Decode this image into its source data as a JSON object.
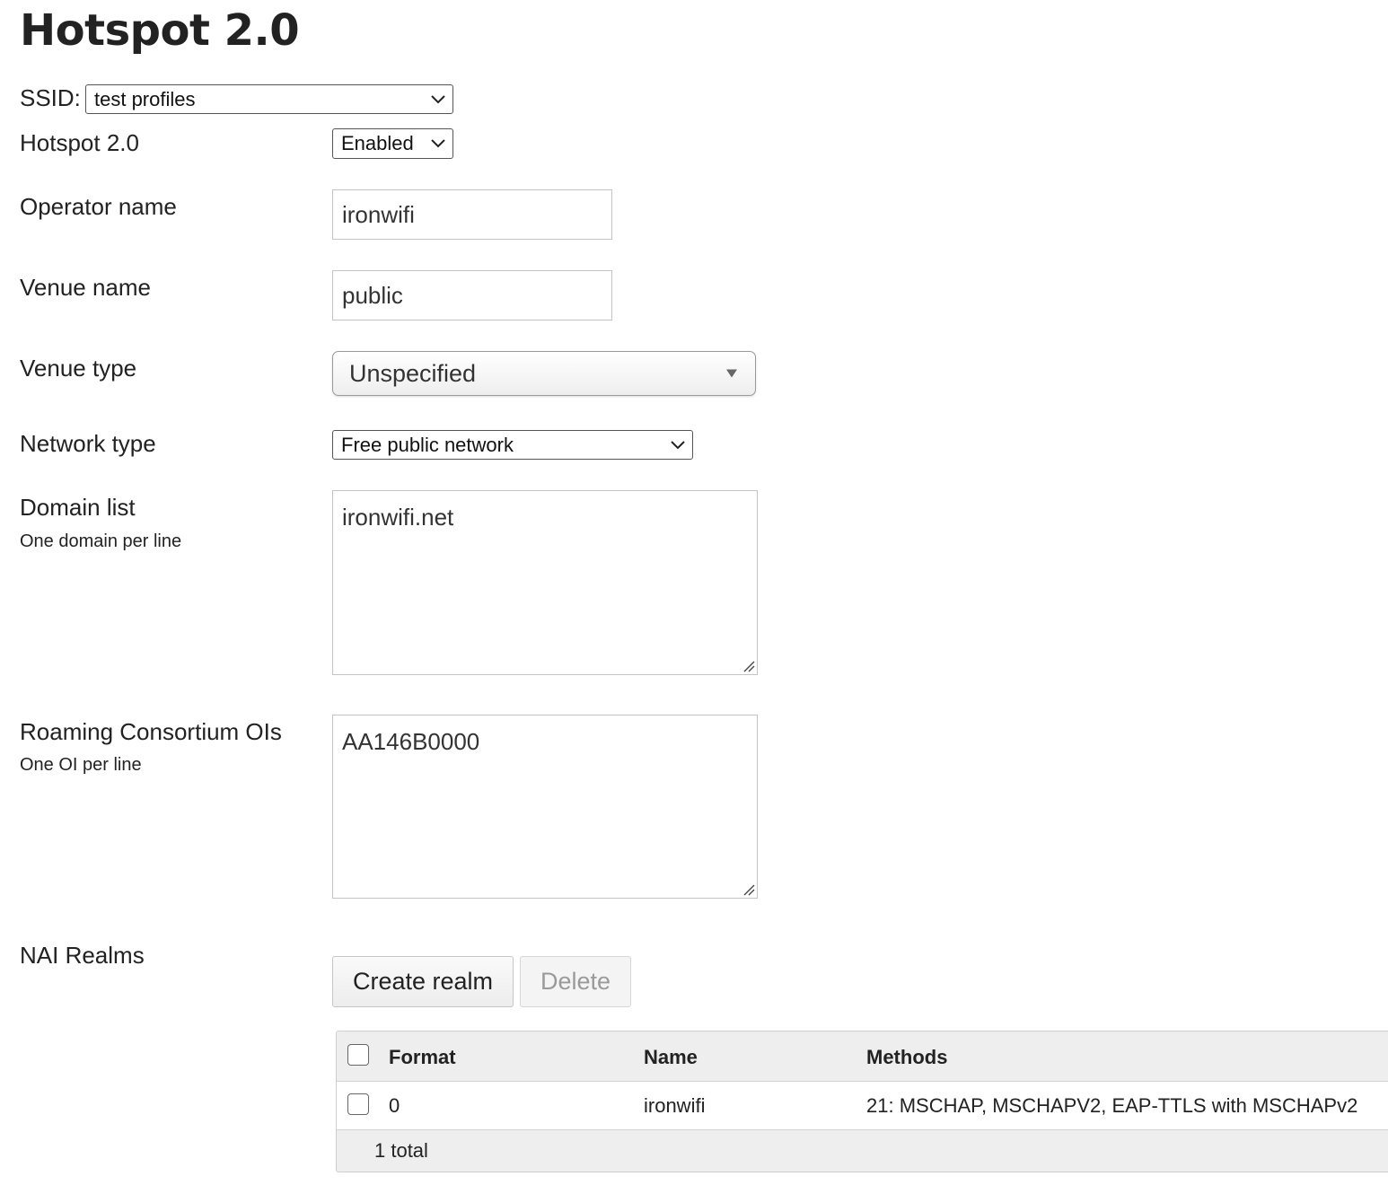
{
  "page": {
    "title": "Hotspot 2.0"
  },
  "ssid": {
    "label": "SSID:",
    "value": "test profiles"
  },
  "form": {
    "hotspot": {
      "label": "Hotspot 2.0",
      "value": "Enabled"
    },
    "operator_name": {
      "label": "Operator name",
      "value": "ironwifi"
    },
    "venue_name": {
      "label": "Venue name",
      "value": "public"
    },
    "venue_type": {
      "label": "Venue type",
      "value": "Unspecified"
    },
    "network_type": {
      "label": "Network type",
      "value": "Free public network"
    },
    "domain_list": {
      "label": "Domain list",
      "hint": "One domain per line",
      "value": "ironwifi.net"
    },
    "roaming_ois": {
      "label": "Roaming Consortium OIs",
      "hint": "One OI per line",
      "value": "AA146B0000"
    },
    "nai_realms": {
      "label": "NAI Realms"
    }
  },
  "realms": {
    "create_label": "Create realm",
    "delete_label": "Delete",
    "columns": [
      "Format",
      "Name",
      "Methods"
    ],
    "rows": [
      {
        "format": "0",
        "name": "ironwifi",
        "methods": "21: MSCHAP, MSCHAPV2, EAP-TTLS with MSCHAPv2"
      }
    ],
    "footer": "1 total"
  },
  "icons": {
    "select_chevron": "chevron-down-icon",
    "fancy_select_arrow": "triangle-down-icon",
    "textarea_resize": "resize-grip-icon"
  }
}
